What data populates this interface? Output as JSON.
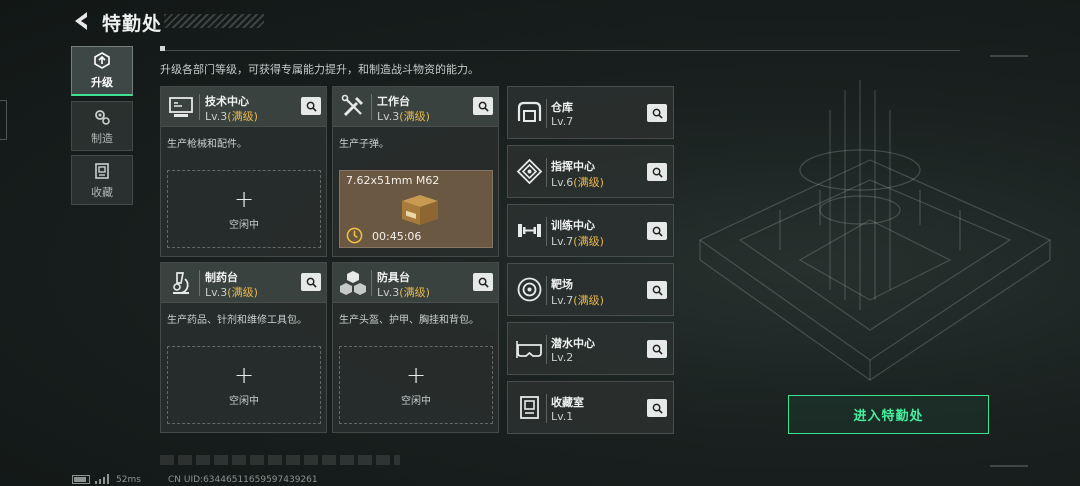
{
  "header": {
    "title": "特勤处"
  },
  "subtitle": "升级各部门等级，可获得专属能力提升，和制造战斗物资的能力。",
  "tabs": [
    {
      "label": "升级",
      "icon": "upgrade-icon",
      "active": true
    },
    {
      "label": "制造",
      "icon": "gears-icon",
      "active": false
    },
    {
      "label": "收藏",
      "icon": "collection-icon",
      "active": false
    }
  ],
  "cards": [
    {
      "name": "技术中心",
      "level": "Lv.3",
      "max": "(满级)",
      "desc": "生产枪械和配件。",
      "slot": {
        "state": "idle",
        "label": "空闲中"
      }
    },
    {
      "name": "工作台",
      "level": "Lv.3",
      "max": "(满级)",
      "desc": "生产子弹。",
      "slot": {
        "state": "active",
        "item": "7.62x51mm M62",
        "timer": "00:45:06"
      }
    },
    {
      "name": "制药台",
      "level": "Lv.3",
      "max": "(满级)",
      "desc": "生产药品、针剂和维修工具包。",
      "slot": {
        "state": "idle",
        "label": "空闲中"
      }
    },
    {
      "name": "防具台",
      "level": "Lv.3",
      "max": "(满级)",
      "desc": "生产头盔、护甲、胸挂和背包。",
      "slot": {
        "state": "idle",
        "label": "空闲中"
      }
    }
  ],
  "facilities": [
    {
      "name": "仓库",
      "level": "Lv.7",
      "max": ""
    },
    {
      "name": "指挥中心",
      "level": "Lv.6",
      "max": "(满级)"
    },
    {
      "name": "训练中心",
      "level": "Lv.7",
      "max": "(满级)"
    },
    {
      "name": "靶场",
      "level": "Lv.7",
      "max": "(满级)"
    },
    {
      "name": "潜水中心",
      "level": "Lv.2",
      "max": ""
    },
    {
      "name": "收藏室",
      "level": "Lv.1",
      "max": ""
    }
  ],
  "enter_button": "进入特勤处",
  "footer": {
    "ping": "52ms",
    "uid": "CN UID:6344651165959743926​1"
  },
  "colors": {
    "accent": "#3ce290",
    "max_level": "#e8b84a",
    "craft_slot": "#6b5842"
  }
}
